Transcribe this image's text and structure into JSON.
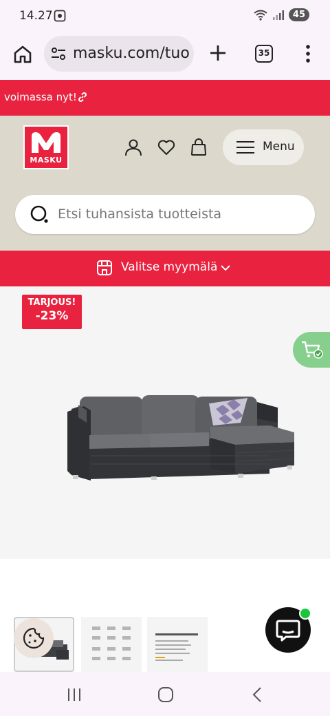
{
  "status_bar": {
    "time": "14.27",
    "battery": "45"
  },
  "browser": {
    "url": "masku.com/tuo",
    "tab_count": "35"
  },
  "promo": {
    "text": "voimassa nyt!"
  },
  "header": {
    "logo_text": "MASKU",
    "menu_label": "Menu"
  },
  "search": {
    "placeholder": "Etsi tuhansista tuotteista"
  },
  "store_selector": {
    "label": "Valitse myymälä"
  },
  "product": {
    "badge_label": "TARJOUS!",
    "badge_discount": "-23%"
  },
  "colors": {
    "brand_red": "#e8223f",
    "header_beige": "#dcd8cb",
    "cart_green": "#86cf8c",
    "chat_online": "#19c83a"
  },
  "icons": {
    "home": "home-icon",
    "site_settings": "tune-icon",
    "new_tab": "plus-icon",
    "more": "more-vert-icon",
    "link": "link-icon",
    "account": "user-icon",
    "wishlist": "heart-icon",
    "cart": "bag-icon",
    "menu": "hamburger-icon",
    "search": "search-icon",
    "store": "store-icon",
    "chevron": "chevron-down-icon",
    "add_to_cart": "cart-check-icon",
    "cookie": "cookie-icon",
    "chat": "chat-icon"
  }
}
